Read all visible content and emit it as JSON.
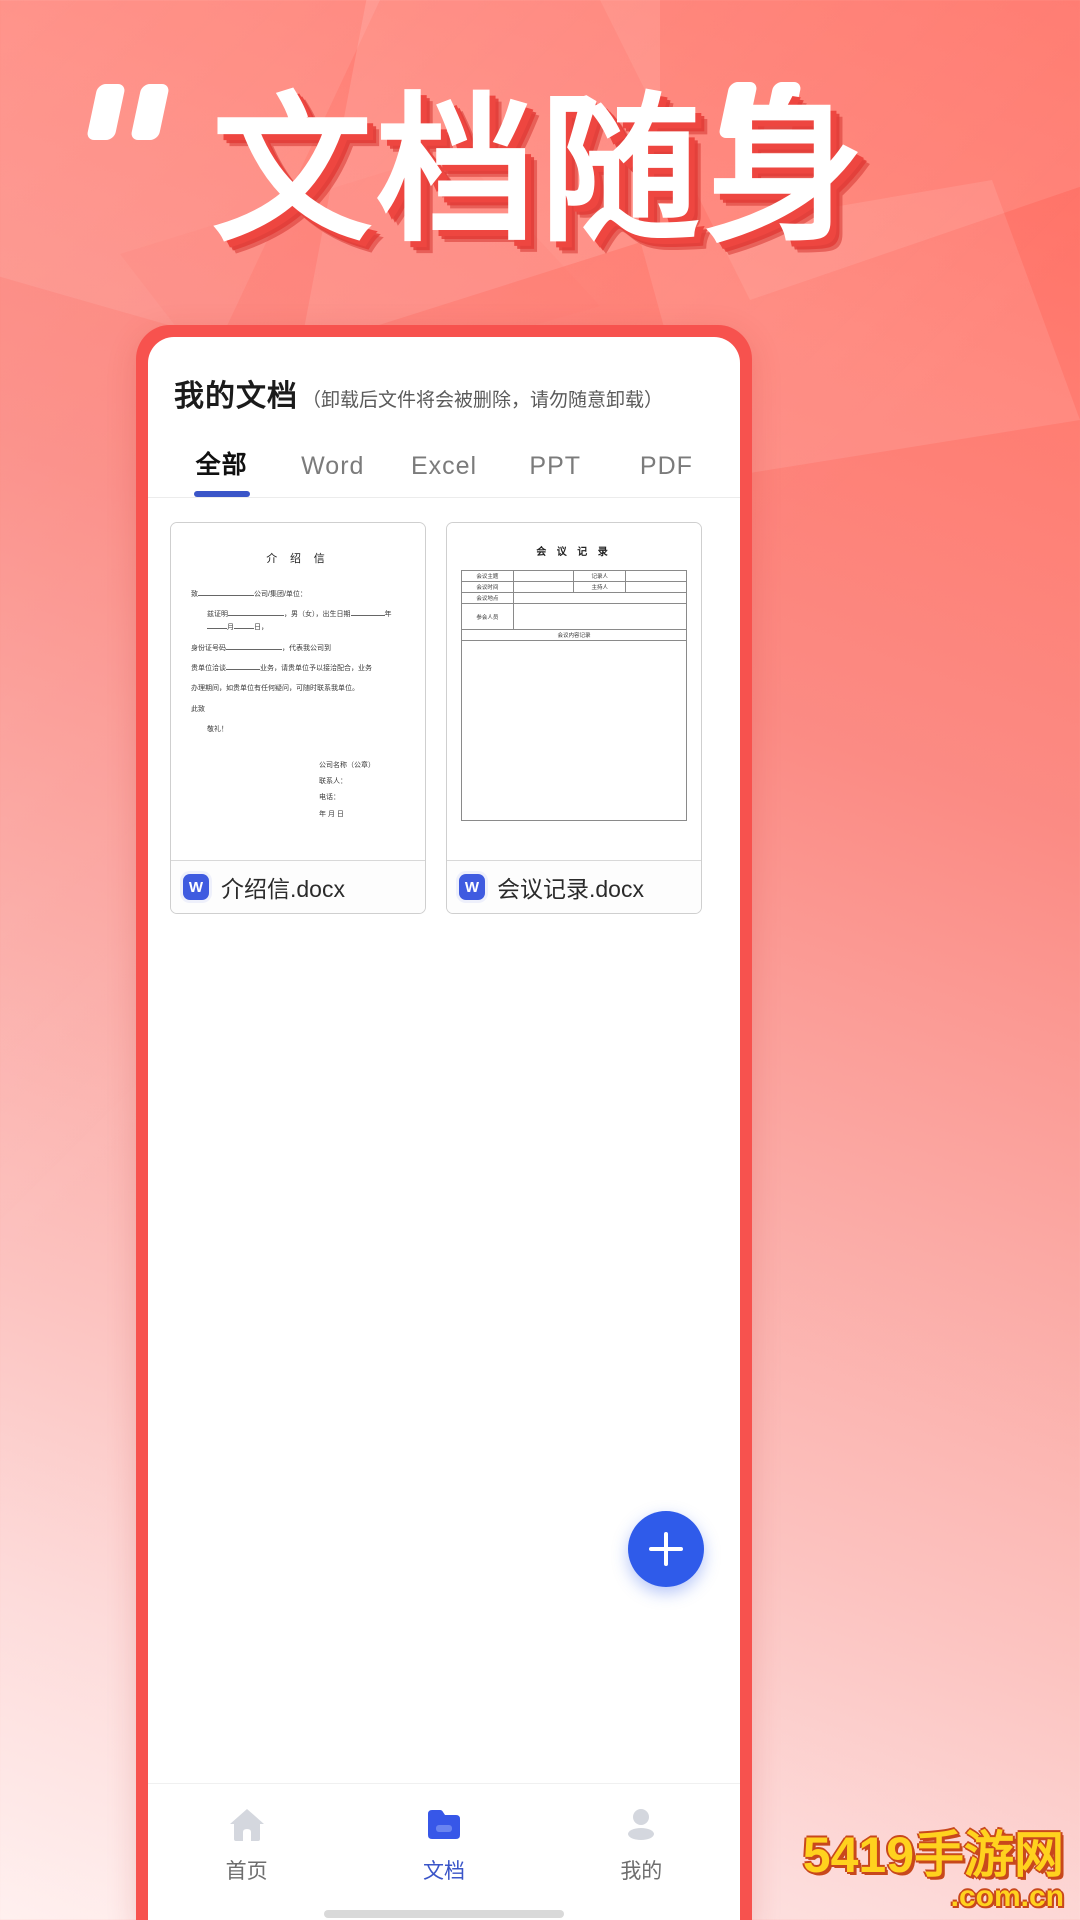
{
  "hero": {
    "quote_open": "“",
    "quote_close": "”",
    "headline": "文档随身"
  },
  "app": {
    "header": {
      "title": "我的文档",
      "subtitle": "（卸载后文件将会被删除，请勿随意卸载）"
    },
    "tabs": [
      {
        "label": "全部",
        "active": true
      },
      {
        "label": "Word",
        "active": false
      },
      {
        "label": "Excel",
        "active": false
      },
      {
        "label": "PPT",
        "active": false
      },
      {
        "label": "PDF",
        "active": false
      }
    ],
    "documents": [
      {
        "name": "介绍信.docx",
        "icon": "word-icon",
        "icon_letter": "W",
        "preview": {
          "title": "介 绍 信",
          "line1_a": "致",
          "line1_b": "公司/集团/单位：",
          "line2_a": "兹证明",
          "line2_b": "，男（女），出生日期",
          "line2_c": "年",
          "line2_d": "月",
          "line2_e": "日，",
          "line3_a": "身份证号码",
          "line3_b": "，代表我公司到",
          "line4": "贵单位洽谈",
          "line4_b": "业务，请贵单位予以接洽配合，业务",
          "line5": "办理期间，如贵单位有任何疑问，可随时联系我单位。",
          "line6": "此致",
          "line7": "敬礼！",
          "sig1": "公司名称（公章）",
          "sig2": "联系人：",
          "sig3": "电话：",
          "sig4": "年   月   日"
        }
      },
      {
        "name": "会议记录.docx",
        "icon": "word-icon",
        "icon_letter": "W",
        "preview": {
          "title": "会 议 记 录",
          "rows": [
            {
              "label": "会议主题",
              "label2": "记录人"
            },
            {
              "label": "会议时间",
              "label2": "主持人"
            },
            {
              "label": "会议地点",
              "label2": ""
            },
            {
              "label": "参会人员",
              "label2": ""
            }
          ],
          "body_header": "会议内容记录"
        }
      }
    ],
    "fab": {
      "label": "+",
      "icon": "plus-icon",
      "color": "#2F5BEA"
    },
    "bottom_nav": [
      {
        "label": "首页",
        "icon": "home-icon",
        "active": false
      },
      {
        "label": "文档",
        "icon": "folder-icon",
        "active": true
      },
      {
        "label": "我的",
        "icon": "person-icon",
        "active": false
      }
    ]
  },
  "watermark": {
    "top": "5419手游网",
    "sub": ".com.cn"
  }
}
